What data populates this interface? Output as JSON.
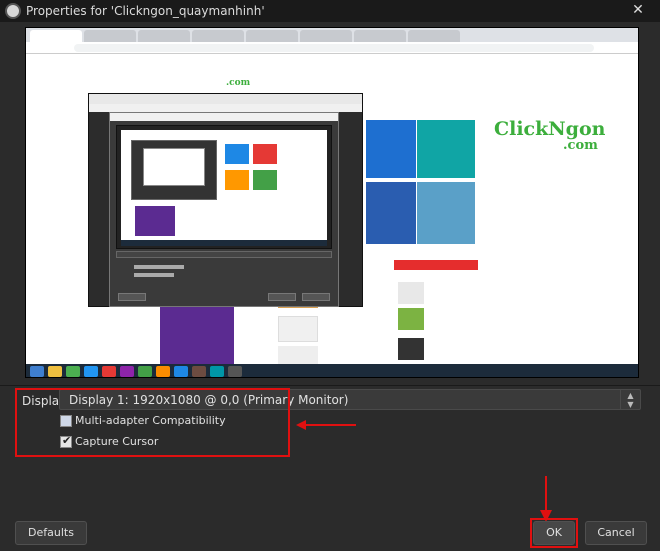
{
  "window": {
    "title": "Properties for 'Clickngon_quaymanhinh'",
    "close_glyph": "✕"
  },
  "preview": {
    "site_logo_com": ".com",
    "watermark_main": "ClickNgon",
    "watermark_com": ".com"
  },
  "properties": {
    "display_label": "Display",
    "display_value": "Display 1: 1920x1080 @ 0,0 (Primary Monitor)",
    "checkboxes": [
      {
        "label": "Multi-adapter Compatibility",
        "checked": false
      },
      {
        "label": "Capture Cursor",
        "checked": true
      }
    ]
  },
  "buttons": {
    "defaults": "Defaults",
    "ok": "OK",
    "cancel": "Cancel"
  },
  "colors": {
    "annotation_red": "#e01010",
    "accent_green": "#3cae3c",
    "dialog_bg": "#2b2b2b"
  },
  "icons": {
    "app": "obs-icon",
    "close": "close-icon",
    "dropdown": "updown-arrows-icon"
  }
}
